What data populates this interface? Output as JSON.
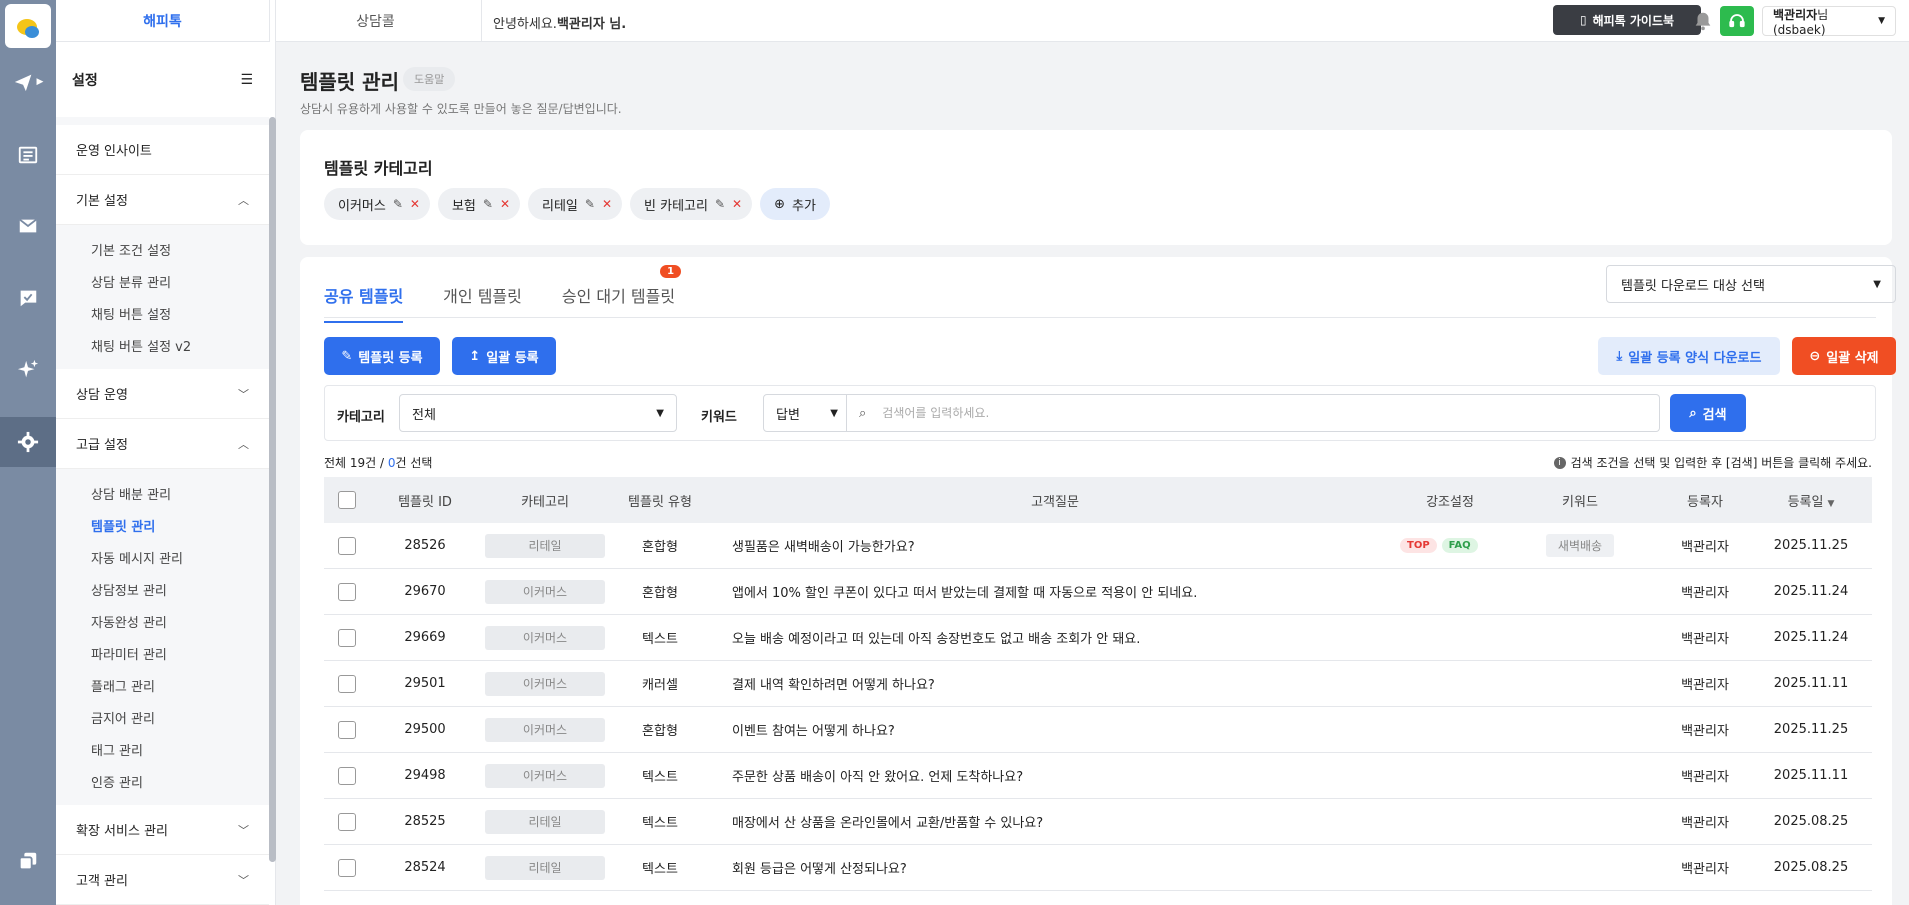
{
  "rail": {
    "items": [
      {
        "icon": "paper-plane-icon"
      },
      {
        "icon": "list-icon"
      },
      {
        "icon": "mail-icon"
      },
      {
        "icon": "chat-check-icon"
      },
      {
        "icon": "sparkle-icon"
      },
      {
        "icon": "gear-icon"
      },
      {
        "icon": "copy-icon"
      }
    ]
  },
  "topbar": {
    "tab1": "해피톡",
    "tab2": "상담콜",
    "greeting_prefix": "안녕하세요.",
    "greeting_name": "백관리자 님.",
    "guide_label": "해피톡 가이드북",
    "user_name": "백관리자",
    "user_suffix": "님(dsbaek)"
  },
  "sidebar": {
    "title": "설정",
    "insight": "운영 인사이트",
    "groups": [
      {
        "label": "기본 설정",
        "expanded": true,
        "items": [
          "기본 조건 설정",
          "상담 분류 관리",
          "채팅 버튼 설정",
          "채팅 버튼 설정 v2"
        ]
      },
      {
        "label": "상담 운영",
        "expanded": false,
        "items": []
      },
      {
        "label": "고급 설정",
        "expanded": true,
        "items": [
          "상담 배분 관리",
          "템플릿 관리",
          "자동 메시지 관리",
          "상담정보 관리",
          "자동완성 관리",
          "파라미터 관리",
          "플래그 관리",
          "금지어 관리",
          "태그 관리",
          "인증 관리"
        ]
      },
      {
        "label": "확장 서비스 관리",
        "expanded": false,
        "items": []
      },
      {
        "label": "고객 관리",
        "expanded": false,
        "items": []
      }
    ]
  },
  "page": {
    "title": "템플릿 관리",
    "help": "도움말",
    "desc": "상담시 유용하게 사용할 수 있도록 만들어 놓은 질문/답변입니다."
  },
  "categories": {
    "title": "템플릿 카테고리",
    "chips": [
      "이커머스",
      "보험",
      "리테일",
      "빈 카테고리"
    ],
    "add_label": "추가"
  },
  "tabs": {
    "shared": "공유 템플릿",
    "personal": "개인 템플릿",
    "pending": "승인 대기 템플릿",
    "pending_count": "1",
    "download_select": "템플릿 다운로드 대상 선택"
  },
  "actions": {
    "register": "템플릿 등록",
    "bulk_register": "일괄 등록",
    "download_form": "일괄 등록 양식 다운로드",
    "bulk_delete": "일괄 삭제"
  },
  "filter": {
    "category_label": "카테고리",
    "category_value": "전체",
    "keyword_label": "키워드",
    "keyword_type": "답변",
    "search_placeholder": "검색어를 입력하세요.",
    "search_button": "검색"
  },
  "summary": {
    "total_prefix": "전체 19건 / ",
    "selected_count": "0",
    "selected_suffix": "건 선택",
    "hint": "검색 조건을 선택 및 입력한 후 [검색] 버튼을 클릭해 주세요."
  },
  "table": {
    "headers": {
      "id": "템플릿 ID",
      "category": "카테고리",
      "type": "템플릿 유형",
      "question": "고객질문",
      "emphasis": "강조설정",
      "keyword": "키워드",
      "registrant": "등록자",
      "date": "등록일"
    },
    "rows": [
      {
        "id": "28526",
        "category": "리테일",
        "type": "혼합형",
        "question": "생필품은 새벽배송이 가능한가요?",
        "em_top": "TOP",
        "em_faq": "FAQ",
        "keyword": "새벽배송",
        "registrant": "백관리자",
        "date": "2025.11.25"
      },
      {
        "id": "29670",
        "category": "이커머스",
        "type": "혼합형",
        "question": "앱에서 10% 할인 쿠폰이 있다고 떠서 받았는데 결제할 때 자동으로 적용이 안 되네요.",
        "registrant": "백관리자",
        "date": "2025.11.24"
      },
      {
        "id": "29669",
        "category": "이커머스",
        "type": "텍스트",
        "question": "오늘 배송 예정이라고 떠 있는데 아직 송장번호도 없고 배송 조회가 안 돼요.",
        "registrant": "백관리자",
        "date": "2025.11.24"
      },
      {
        "id": "29501",
        "category": "이커머스",
        "type": "캐러셀",
        "question": "결제 내역 확인하려면 어떻게 하나요?",
        "registrant": "백관리자",
        "date": "2025.11.11"
      },
      {
        "id": "29500",
        "category": "이커머스",
        "type": "혼합형",
        "question": "이벤트 참여는 어떻게 하나요?",
        "registrant": "백관리자",
        "date": "2025.11.25"
      },
      {
        "id": "29498",
        "category": "이커머스",
        "type": "텍스트",
        "question": "주문한 상품 배송이 아직 안 왔어요. 언제 도착하나요?",
        "registrant": "백관리자",
        "date": "2025.11.11"
      },
      {
        "id": "28525",
        "category": "리테일",
        "type": "텍스트",
        "question": "매장에서 산 상품을 온라인몰에서 교환/반품할 수 있나요?",
        "registrant": "백관리자",
        "date": "2025.08.25"
      },
      {
        "id": "28524",
        "category": "리테일",
        "type": "텍스트",
        "question": "회원 등급은 어떻게 산정되나요?",
        "registrant": "백관리자",
        "date": "2025.08.25"
      }
    ]
  }
}
